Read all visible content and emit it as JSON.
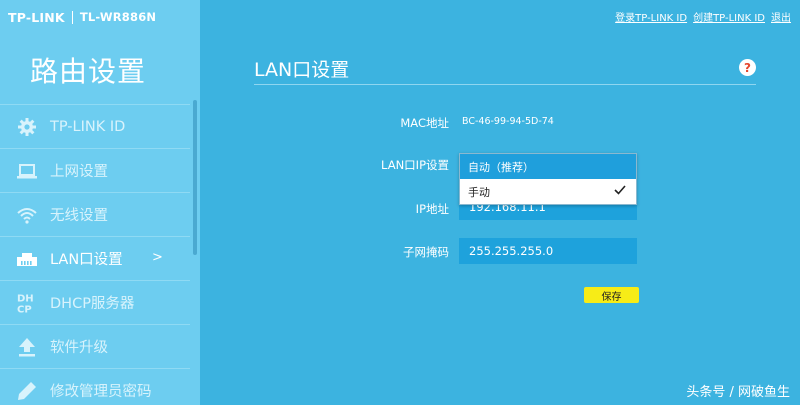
{
  "brand": {
    "name": "TP-LINK",
    "model": "TL-WR886N"
  },
  "sidebar": {
    "title": "路由设置",
    "items": [
      {
        "label": "TP-LINK ID",
        "icon": "gear-icon"
      },
      {
        "label": "上网设置",
        "icon": "laptop-icon"
      },
      {
        "label": "无线设置",
        "icon": "wifi-icon"
      },
      {
        "label": "LAN口设置",
        "icon": "lan-icon",
        "active": true,
        "arrow": ">"
      },
      {
        "label": "DHCP服务器",
        "icon": "dhcp-icon"
      },
      {
        "label": "软件升级",
        "icon": "upload-icon"
      },
      {
        "label": "修改管理员密码",
        "icon": "pencil-icon"
      }
    ]
  },
  "toplinks": {
    "login": "登录TP-LINK ID",
    "create": "创建TP-LINK ID",
    "exit": "退出"
  },
  "main": {
    "title": "LAN口设置",
    "mac": {
      "label": "MAC地址",
      "value": "BC-46-99-94-5D-74"
    },
    "lan_ip_setting": {
      "label": "LAN口IP设置",
      "options": [
        "自动（推荐）",
        "手动"
      ],
      "selected": "自动（推荐）"
    },
    "ip": {
      "label": "IP地址",
      "value": "192.168.11.1"
    },
    "mask": {
      "label": "子网掩码",
      "value": "255.255.255.0"
    },
    "save_label": "保存"
  },
  "watermark": "头条号 / 网破鱼生",
  "colors": {
    "sidebar": "#6dcdf0",
    "main": "#3cb3e0",
    "field": "#1ea2dc",
    "save": "#f7ec17",
    "help": "#e5472e"
  }
}
